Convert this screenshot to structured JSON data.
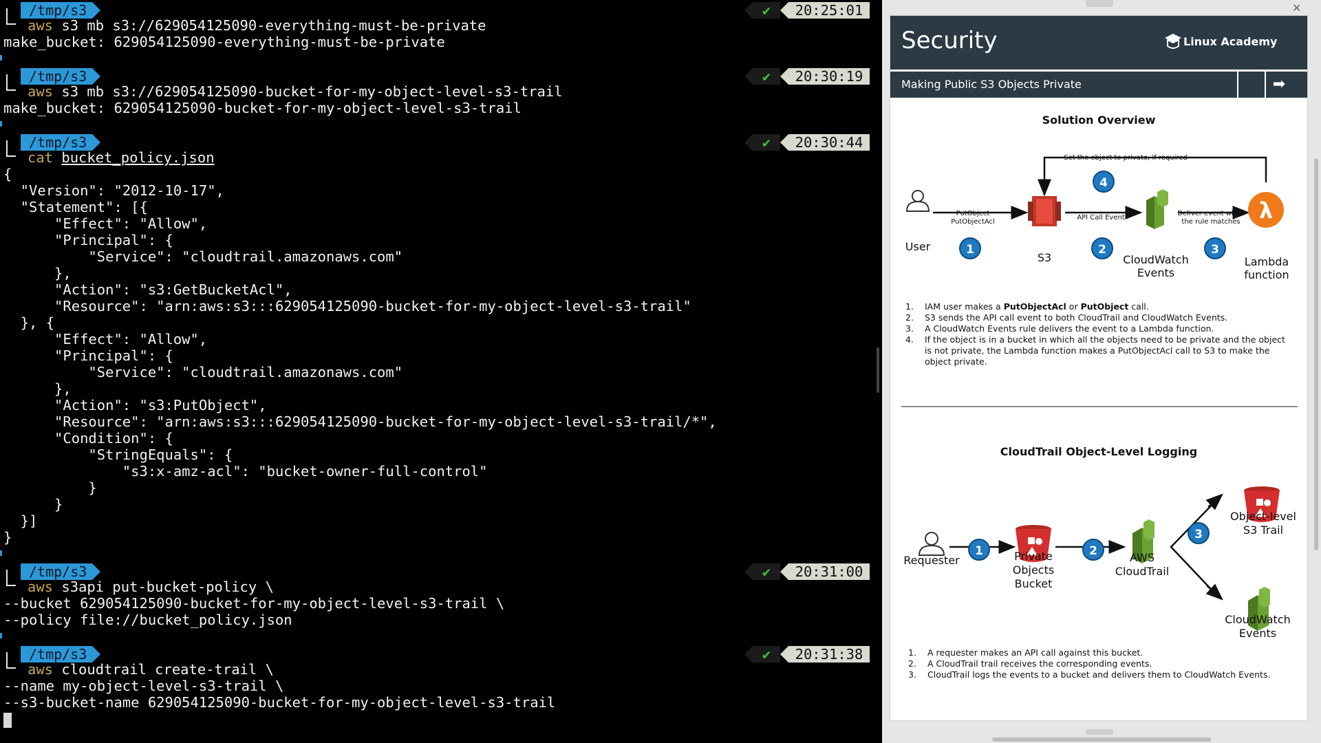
{
  "terminal": {
    "blocks": [
      {
        "dir": "/tmp/s3",
        "time": "20:25:01",
        "ok": "✔",
        "cmd_kw": "aws",
        "cmd_rest": " s3 mb s3://629054125090-everything-must-be-private",
        "output": [
          "make_bucket: 629054125090-everything-must-be-private"
        ]
      },
      {
        "dir": "/tmp/s3",
        "time": "20:30:19",
        "ok": "✔",
        "cmd_kw": "aws",
        "cmd_rest": " s3 mb s3://629054125090-bucket-for-my-object-level-s3-trail",
        "output": [
          "make_bucket: 629054125090-bucket-for-my-object-level-s3-trail"
        ]
      },
      {
        "dir": "/tmp/s3",
        "time": "20:30:44",
        "ok": "✔",
        "cmd_kw": "cat",
        "cmd_arg": "bucket_policy.json",
        "output": [
          "{",
          "  \"Version\": \"2012-10-17\",",
          "  \"Statement\": [{",
          "      \"Effect\": \"Allow\",",
          "      \"Principal\": {",
          "          \"Service\": \"cloudtrail.amazonaws.com\"",
          "      },",
          "      \"Action\": \"s3:GetBucketAcl\",",
          "      \"Resource\": \"arn:aws:s3:::629054125090-bucket-for-my-object-level-s3-trail\"",
          "  }, {",
          "      \"Effect\": \"Allow\",",
          "      \"Principal\": {",
          "          \"Service\": \"cloudtrail.amazonaws.com\"",
          "      },",
          "      \"Action\": \"s3:PutObject\",",
          "      \"Resource\": \"arn:aws:s3:::629054125090-bucket-for-my-object-level-s3-trail/*\",",
          "      \"Condition\": {",
          "          \"StringEquals\": {",
          "              \"s3:x-amz-acl\": \"bucket-owner-full-control\"",
          "          }",
          "      }",
          "  }]",
          "}"
        ]
      },
      {
        "dir": "/tmp/s3",
        "time": "20:31:00",
        "ok": "✔",
        "cmd_kw": "aws",
        "cmd_rest": " s3api put-bucket-policy \\",
        "output": [
          "--bucket 629054125090-bucket-for-my-object-level-s3-trail \\",
          "--policy file://bucket_policy.json"
        ]
      },
      {
        "dir": "/tmp/s3",
        "time": "20:31:38",
        "ok": "✔",
        "cmd_kw": "aws",
        "cmd_rest": " cloudtrail create-trail \\",
        "output": [
          "--name my-object-level-s3-trail \\",
          "--s3-bucket-name 629054125090-bucket-for-my-object-level-s3-trail"
        ]
      }
    ]
  },
  "slide": {
    "title": "Security",
    "brand": "Linux Academy",
    "subtitle": "Making Public S3 Objects Private",
    "next_icon": "➡",
    "solution": {
      "heading": "Solution Overview",
      "top_note": "Set the object to private, if required",
      "user": "User",
      "s3": "S3",
      "cloudwatch": "CloudWatch Events",
      "lambda": "Lambda function",
      "arrow1_l1": "PutObject",
      "arrow1_l2": "PutObjectAcl",
      "arrow2": "API Call Event",
      "arrow3_l1": "Deliver event when",
      "arrow3_l2": "the rule matches",
      "badges": [
        "1",
        "2",
        "3",
        "4"
      ],
      "list": [
        {
          "n": "1.",
          "text": "IAM user makes a PutObjectAcl or PutObject call."
        },
        {
          "n": "2.",
          "text": "S3 sends the API call event to both CloudTrail and CloudWatch Events."
        },
        {
          "n": "3.",
          "text": "A CloudWatch Events rule delivers the event to a Lambda function."
        },
        {
          "n": "4.",
          "text": "If the object is in a bucket in which all the objects need to be private and the object is not private, the Lambda function  makes a PutObjectAcl call to S3 to make the object private."
        }
      ],
      "list1_pre": "IAM user makes a ",
      "list1_b1": "PutObjectAcl",
      "list1_mid": " or ",
      "list1_b2": "PutObject",
      "list1_post": " call."
    },
    "logging": {
      "heading": "CloudTrail Object-Level Logging",
      "requester": "Requester",
      "bucket": "Private Objects Bucket",
      "cloudtrail": "AWS CloudTrail",
      "trail": "Object-level S3 Trail",
      "cwevents": "CloudWatch Events",
      "badges": [
        "1",
        "2",
        "3"
      ],
      "list": [
        {
          "n": "1.",
          "text": "A requester makes an API call against this bucket."
        },
        {
          "n": "2.",
          "text": "A CloudTrail trail receives the corresponding events."
        },
        {
          "n": "3.",
          "text": "CloudTrail logs the events to a bucket  and delivers them to CloudWatch Events."
        }
      ]
    }
  },
  "colors": {
    "prompt_dir_bg": "#2c98d8",
    "time_bg": "#d9d9d0",
    "ok_green": "#3fbf3f",
    "slide_header": "#2b3a44",
    "badge_blue": "#1f7ac2",
    "aws_red": "#d42e2e",
    "aws_green": "#6aa132",
    "lambda_orange": "#ef7a1a"
  }
}
